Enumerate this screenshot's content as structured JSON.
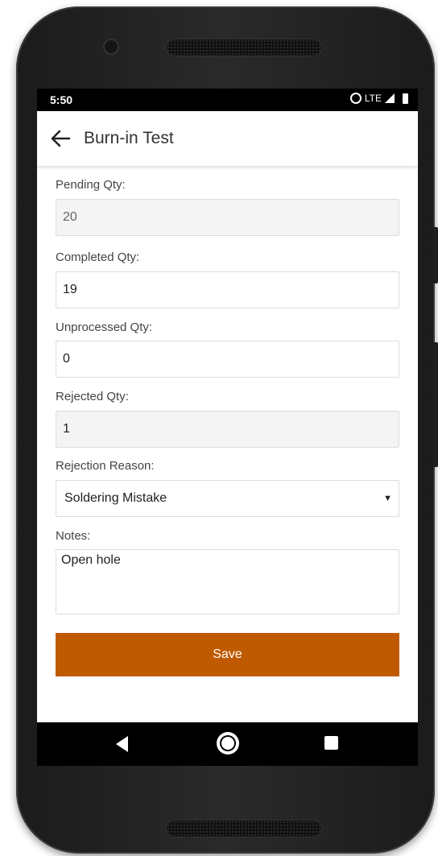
{
  "status_bar": {
    "time": "5:50",
    "network": "LTE",
    "icons": [
      "alarm-icon",
      "signal-icon",
      "battery-icon"
    ]
  },
  "app_bar": {
    "back_icon": "arrow-left-icon",
    "title": "Burn-in Test"
  },
  "form": {
    "pending_qty": {
      "label": "Pending Qty:",
      "value": "20",
      "readonly": true
    },
    "completed_qty": {
      "label": "Completed Qty:",
      "value": "19"
    },
    "unprocessed_qty": {
      "label": "Unprocessed Qty:",
      "value": "0"
    },
    "rejected_qty": {
      "label": "Rejected Qty:",
      "value": "1",
      "readonly": true
    },
    "rejection_reason": {
      "label": "Rejection Reason:",
      "selected": "Soldering Mistake",
      "caret": "▼"
    },
    "notes": {
      "label": "Notes:",
      "value": "Open hole"
    },
    "save_label": "Save"
  },
  "colors": {
    "accent": "#c05a00",
    "readonly_bg": "#f4f4f4",
    "border": "#dcdcdc"
  },
  "nav_bar": {
    "icons": [
      "back-triangle-icon",
      "home-circle-icon",
      "recents-square-icon"
    ]
  }
}
